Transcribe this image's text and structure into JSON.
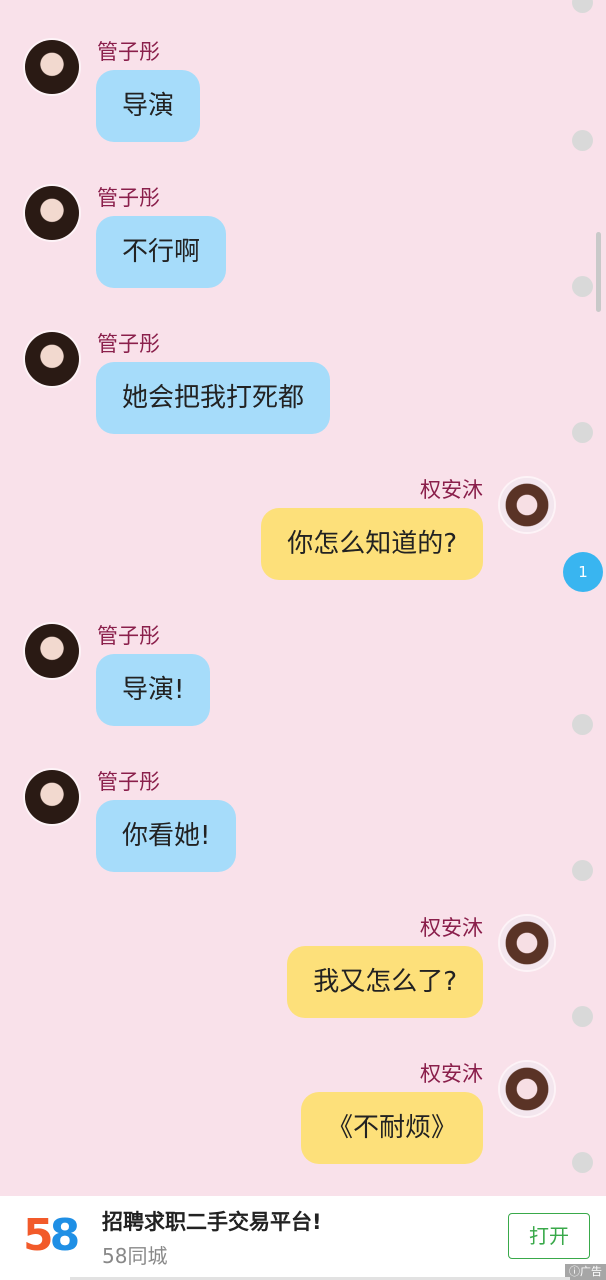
{
  "chat": {
    "unread_count": "1",
    "messages": [
      {
        "side": "left",
        "sender": "管子彤",
        "text": "导演"
      },
      {
        "side": "left",
        "sender": "管子彤",
        "text": "不行啊"
      },
      {
        "side": "left",
        "sender": "管子彤",
        "text": "她会把我打死都"
      },
      {
        "side": "right",
        "sender": "权安沐",
        "text": "你怎么知道的?"
      },
      {
        "side": "left",
        "sender": "管子彤",
        "text": "导演!"
      },
      {
        "side": "left",
        "sender": "管子彤",
        "text": "你看她!"
      },
      {
        "side": "right",
        "sender": "权安沐",
        "text": "我又怎么了?"
      },
      {
        "side": "right",
        "sender": "权安沐",
        "text": "《不耐烦》"
      }
    ]
  },
  "ad": {
    "logo_left": "5",
    "logo_right": "8",
    "title": "招聘求职二手交易平台!",
    "subtitle": "58同城",
    "open_label": "打开",
    "tag": "广告"
  },
  "colors": {
    "background": "#f9e1ea",
    "left_bubble": "#a6dcfa",
    "right_bubble": "#fde07a",
    "sender_name": "#8a1f4b",
    "badge": "#39b5f0"
  }
}
